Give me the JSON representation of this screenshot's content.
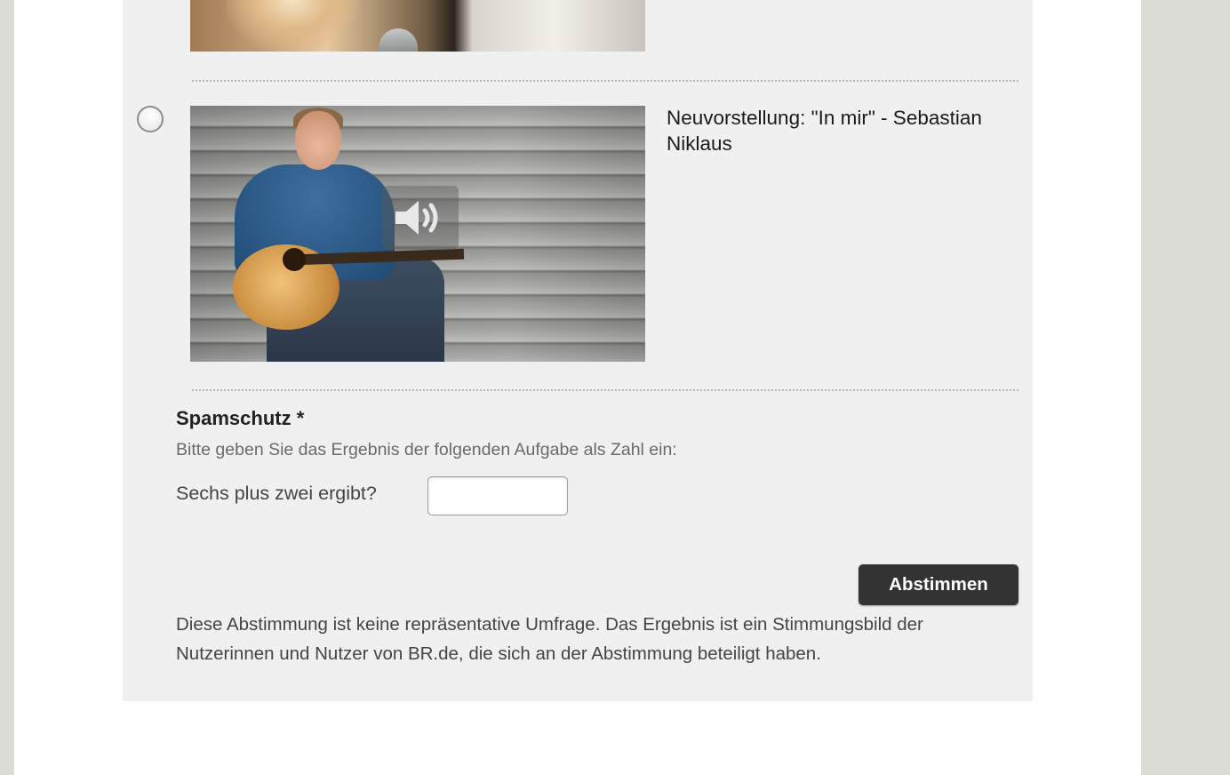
{
  "poll": {
    "options": [
      {
        "image_alt": "",
        "title": ""
      },
      {
        "title": "Neuvorstellung: \"In mir\" - Sebastian Niklaus",
        "media_icon": "speaker-volume-icon"
      }
    ]
  },
  "spam": {
    "heading": "Spamschutz *",
    "instruction": "Bitte geben Sie das Ergebnis der folgenden Aufgabe als Zahl ein:",
    "question": "Sechs plus zwei ergibt?",
    "answer_value": "",
    "answer_placeholder": ""
  },
  "vote_button": "Abstimmen",
  "disclaimer": "Diese Abstimmung ist keine repräsentative Umfrage. Das Ergebnis ist ein Stimmungsbild der Nutzerinnen und Nutzer von BR.de, die sich an der Abstimmung beteiligt haben.",
  "colors": {
    "panel": "#f0f0f0",
    "button": "#333333",
    "side": "#dcdcd7"
  }
}
